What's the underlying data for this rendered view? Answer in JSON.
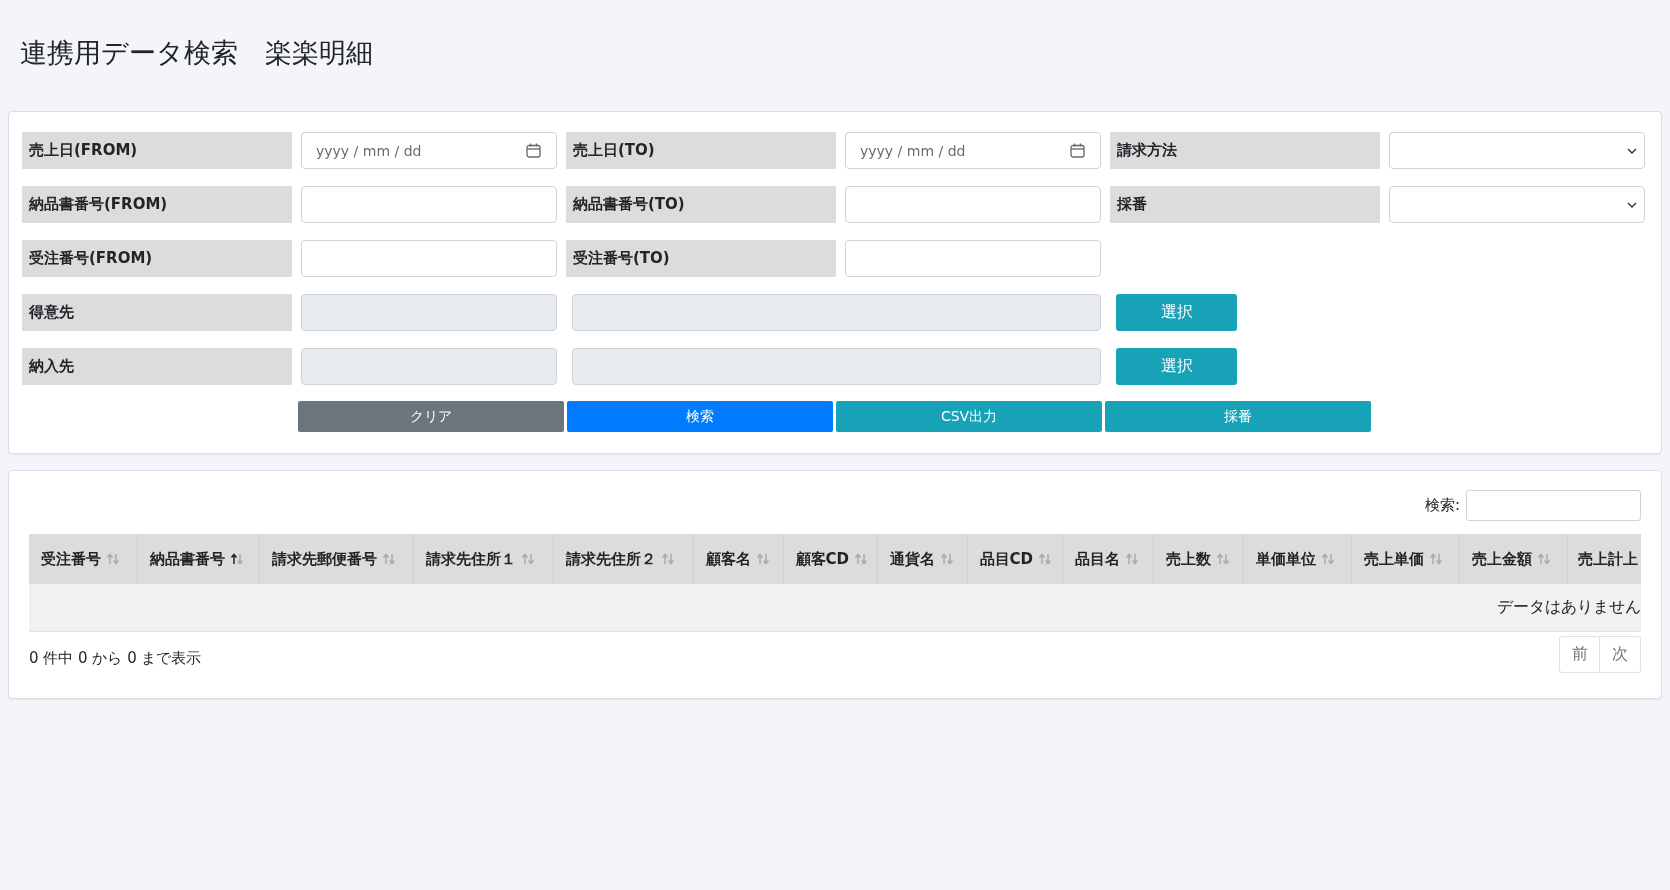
{
  "title": "連携用データ検索　楽楽明細",
  "filters": [
    {
      "kind": "label",
      "text": "売上日(FROM)"
    },
    {
      "kind": "date",
      "placeholder": "yyyy / mm / dd"
    },
    {
      "kind": "label",
      "text": "売上日(TO)"
    },
    {
      "kind": "date",
      "placeholder": "yyyy / mm / dd"
    },
    {
      "kind": "label",
      "text": "請求方法"
    },
    {
      "kind": "select"
    },
    {
      "kind": "label",
      "text": "納品書番号(FROM)"
    },
    {
      "kind": "text"
    },
    {
      "kind": "label",
      "text": "納品書番号(TO)"
    },
    {
      "kind": "text"
    },
    {
      "kind": "label",
      "text": "採番"
    },
    {
      "kind": "select"
    },
    {
      "kind": "label",
      "text": "受注番号(FROM)"
    },
    {
      "kind": "text"
    },
    {
      "kind": "label",
      "text": "受注番号(TO)"
    },
    {
      "kind": "text"
    },
    {
      "kind": "empty"
    },
    {
      "kind": "empty"
    },
    {
      "kind": "label",
      "text": "得意先"
    },
    {
      "kind": "readonly"
    },
    {
      "kind": "readonly_wide"
    },
    {
      "kind": "button",
      "text": "選択"
    },
    {
      "kind": "empty"
    },
    {
      "kind": "label",
      "text": "納入先"
    },
    {
      "kind": "readonly"
    },
    {
      "kind": "readonly_wide"
    },
    {
      "kind": "button",
      "text": "選択"
    },
    {
      "kind": "empty"
    }
  ],
  "actions": [
    {
      "label": "クリア",
      "color": "#6c757d"
    },
    {
      "label": "検索",
      "color": "#007bff"
    },
    {
      "label": "CSV出力",
      "color": "#17a2b8"
    },
    {
      "label": "採番",
      "color": "#17a2b8"
    }
  ],
  "table": {
    "search_label": "検索:",
    "columns": [
      {
        "label": "受注番号",
        "sorted": false
      },
      {
        "label": "納品書番号",
        "sorted": true
      },
      {
        "label": "請求先郵便番号",
        "sorted": false
      },
      {
        "label": "請求先住所１",
        "sorted": false
      },
      {
        "label": "請求先住所２",
        "sorted": false
      },
      {
        "label": "顧客名",
        "sorted": false
      },
      {
        "label": "顧客CD",
        "sorted": false
      },
      {
        "label": "通貨名",
        "sorted": false
      },
      {
        "label": "品目CD",
        "sorted": false
      },
      {
        "label": "品目名",
        "sorted": false
      },
      {
        "label": "売上数",
        "sorted": false
      },
      {
        "label": "単価単位",
        "sorted": false
      },
      {
        "label": "売上単価",
        "sorted": false
      },
      {
        "label": "売上金額",
        "sorted": false
      },
      {
        "label": "売上計上"
      }
    ],
    "empty_message": "データはありません",
    "info": "0 件中 0 から 0 まで表示",
    "pagination": [
      {
        "label": "前",
        "disabled": true
      },
      {
        "label": "次",
        "disabled": true
      }
    ]
  }
}
